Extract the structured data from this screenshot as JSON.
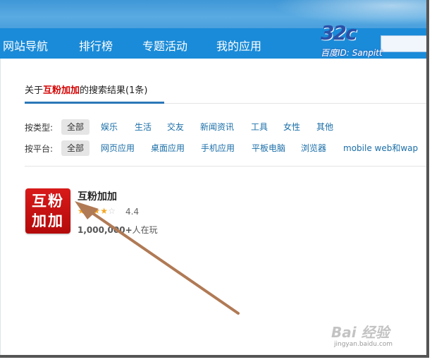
{
  "nav": {
    "items": [
      {
        "label": "网站导航"
      },
      {
        "label": "排行榜"
      },
      {
        "label": "专题活动"
      },
      {
        "label": "我的应用"
      }
    ]
  },
  "watermark": {
    "logo_text": "32c",
    "id_text": "百度ID: Sanpitt"
  },
  "search_result": {
    "prefix": "关于",
    "keyword": "互粉加加",
    "suffix": "的搜索结果(1条)"
  },
  "filters": {
    "type_label": "按类型:",
    "type_options": [
      "全部",
      "娱乐",
      "生活",
      "交友",
      "新闻资讯",
      "工具",
      "女性",
      "其他"
    ],
    "platform_label": "按平台:",
    "platform_options": [
      "全部",
      "网页应用",
      "桌面应用",
      "手机应用",
      "平板电脑",
      "浏览器",
      "mobile web和wap"
    ]
  },
  "app": {
    "icon_line1": "互粉",
    "icon_line2": "加加",
    "name": "互粉加加",
    "rating": "4.4",
    "rating_value": 4.4,
    "players_count": "1,000,000+",
    "players_suffix": "人在玩"
  },
  "bottom_watermark": {
    "logo": "Bai 经验",
    "url": "jingyan.baidu.com"
  },
  "colors": {
    "nav_bg": "#1a8bd8",
    "keyword": "#d40000",
    "link": "#1a6ea8",
    "star": "#f5a623",
    "arrow": "#b07a55"
  }
}
